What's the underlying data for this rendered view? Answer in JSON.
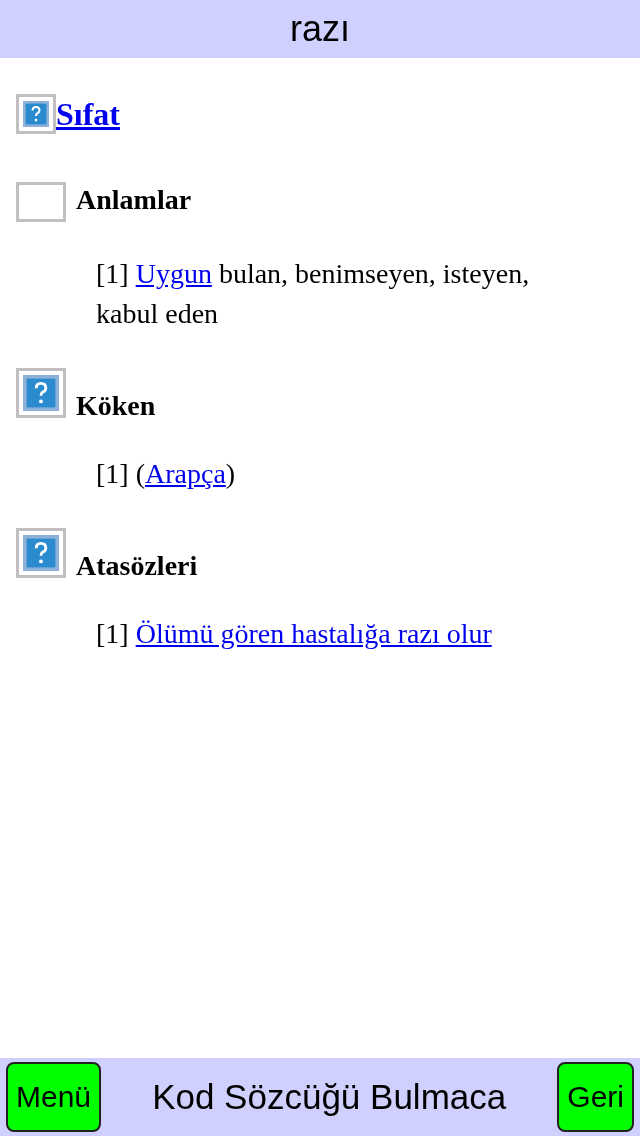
{
  "header": {
    "title": "razı"
  },
  "word_class": {
    "kind": "help",
    "label": "Sıfat"
  },
  "sections": [
    {
      "kind": "blank",
      "title": "Anlamlar",
      "entries": [
        {
          "number": "[1]",
          "parts": [
            {
              "kind": "link",
              "text": "Uygun"
            },
            {
              "kind": "text",
              "text": " bulan, benimseyen, isteyen, kabul eden"
            }
          ]
        }
      ]
    },
    {
      "kind": "help",
      "title": "Köken",
      "entries": [
        {
          "number": "[1]",
          "parts": [
            {
              "kind": "text",
              "text": "("
            },
            {
              "kind": "link",
              "text": "Arapça"
            },
            {
              "kind": "text",
              "text": ")"
            }
          ]
        }
      ]
    },
    {
      "kind": "help",
      "title": "Atasözleri",
      "entries": [
        {
          "number": "[1]",
          "parts": [
            {
              "kind": "link",
              "text": "Ölümü gören hastalığa razı olur"
            }
          ]
        }
      ]
    }
  ],
  "footer": {
    "left_button": "Menü",
    "title": "Kod Sözcüğü Bulmaca",
    "right_button": "Geri"
  }
}
